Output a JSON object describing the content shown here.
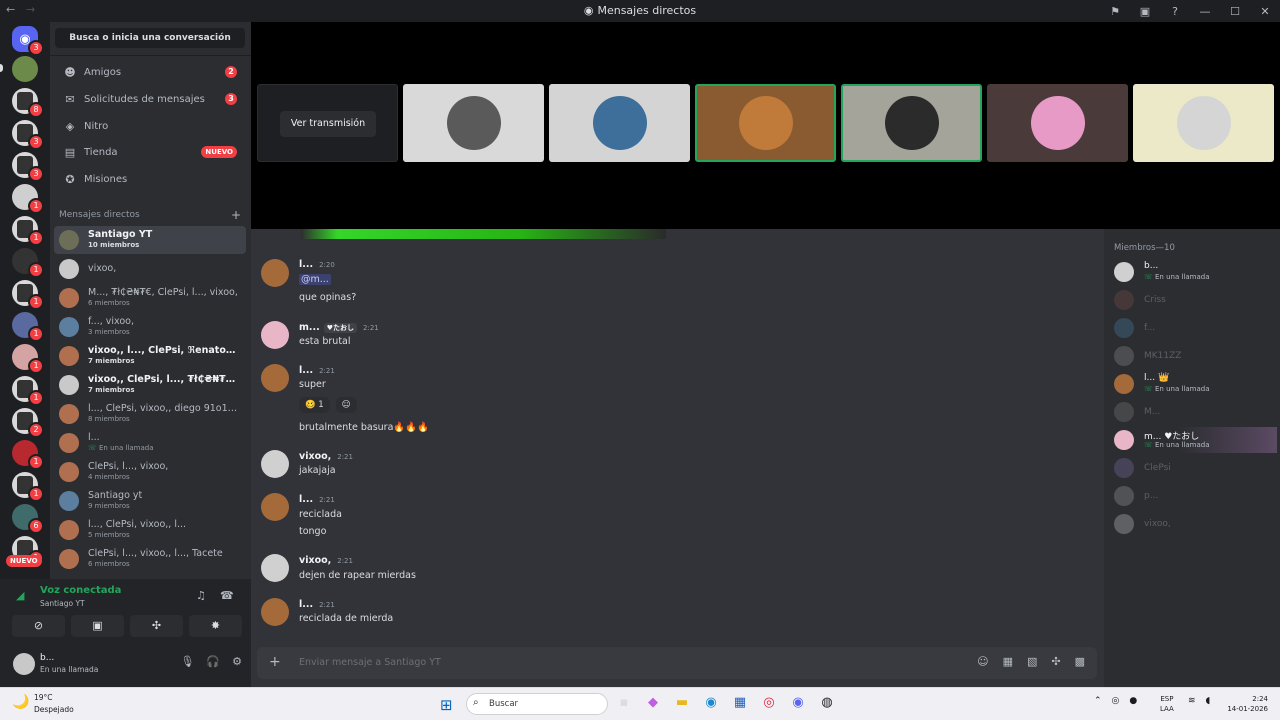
{
  "window": {
    "title": "Mensajes directos",
    "back": "←",
    "forward": "→",
    "controls": [
      "⚑",
      "▣",
      "?",
      "—",
      "☐",
      "✕"
    ]
  },
  "dm_sidebar": {
    "search_label": "Busca o inicia una conversación",
    "nav": [
      {
        "label": "Amigos",
        "icon": "friends-icon",
        "count": "2"
      },
      {
        "label": "Solicitudes de mensajes",
        "icon": "message-requests-icon",
        "count": "3"
      },
      {
        "label": "Nitro",
        "icon": "nitro-icon"
      },
      {
        "label": "Tienda",
        "icon": "shop-icon",
        "badge": "NUEVO"
      },
      {
        "label": "Misiones",
        "icon": "quests-icon"
      }
    ],
    "section_label": "Mensajes directos",
    "dms": [
      {
        "name": "Santiago YT",
        "sub": "10 miembros"
      },
      {
        "name": "vixoo,",
        "sub": ""
      },
      {
        "name": "M..., ₮ł₵₴₦₮€, ClePsi, l..., vixoo,",
        "sub": "6 miembros"
      },
      {
        "name": "f..., vixoo,",
        "sub": "3 miembros"
      },
      {
        "name": "vixoo,, l..., ClePsi, ℜenato, MK...",
        "sub": "7 miembros"
      },
      {
        "name": "vixoo,, ClePsi, l..., ₮ł₵₴₦₮€, p...",
        "sub": "7 miembros"
      },
      {
        "name": "l..., ClePsi, vixoo,, diego 91o10, ...",
        "sub": "8 miembros"
      },
      {
        "name": "l...",
        "sub": "En una llamada"
      },
      {
        "name": "ClePsi, l..., vixoo,",
        "sub": "4 miembros"
      },
      {
        "name": "Santiago yt",
        "sub": "9 miembros"
      },
      {
        "name": "l..., ClePsi, vixoo,, l...",
        "sub": "5 miembros"
      },
      {
        "name": "ClePsi, l..., vixoo,, l..., Tacete",
        "sub": "6 miembros"
      }
    ]
  },
  "rail": {
    "badges": [
      "3",
      "8",
      "3",
      "3",
      "1",
      "1",
      "1",
      "1",
      "1",
      "1",
      "1",
      "2",
      "1",
      "1",
      "6",
      "1"
    ],
    "new_label": "NUEVO"
  },
  "voice": {
    "status": "Voz conectada",
    "channel": "Santiago YT",
    "user_name": "b...",
    "user_status": "En una llamada"
  },
  "streams": {
    "watch_label": "Ver transmisión"
  },
  "chat": {
    "messages": [
      {
        "author": "l...",
        "time": "2:20",
        "lines": [
          "@m...",
          "que opinas?"
        ]
      },
      {
        "author": "m...",
        "tag": "♥たおし",
        "time": "2:21",
        "lines": [
          "esta brutal"
        ]
      },
      {
        "author": "l...",
        "time": "2:21",
        "lines": [
          "super",
          "brutalmente basura🔥🔥🔥"
        ],
        "reaction": {
          "emoji": "🥴",
          "count": "1"
        }
      },
      {
        "author": "vixoo,",
        "time": "2:21",
        "lines": [
          "jakajaja"
        ]
      },
      {
        "author": "l...",
        "time": "2:21",
        "lines": [
          "reciclada",
          "tongo"
        ]
      },
      {
        "author": "vixoo,",
        "time": "2:21",
        "lines": [
          "dejen de rapear mierdas"
        ]
      },
      {
        "author": "l...",
        "time": "2:21",
        "lines": [
          "reciclada de mierda"
        ]
      }
    ],
    "composer_placeholder": "Enviar mensaje a Santiago YT"
  },
  "members": {
    "header": "Miembros—10",
    "list": [
      {
        "name": "b...",
        "status": "En una llamada"
      },
      {
        "name": "Criss",
        "status": ""
      },
      {
        "name": "f...",
        "status": ""
      },
      {
        "name": "MK11ZZ",
        "status": ""
      },
      {
        "name": "l... 👑",
        "status": "En una llamada"
      },
      {
        "name": "M...",
        "status": ""
      },
      {
        "name": "m... ♥たおし",
        "status": "En una llamada"
      },
      {
        "name": "ClePsi",
        "status": ""
      },
      {
        "name": "p...",
        "status": ""
      },
      {
        "name": "vixoo,",
        "status": ""
      }
    ]
  },
  "taskbar": {
    "weather_temp": "19°C",
    "weather_desc": "Despejado",
    "search_label": "Buscar",
    "lang_1": "ESP",
    "lang_2": "LAA",
    "time": "2:24",
    "date": "14-01-2026"
  }
}
